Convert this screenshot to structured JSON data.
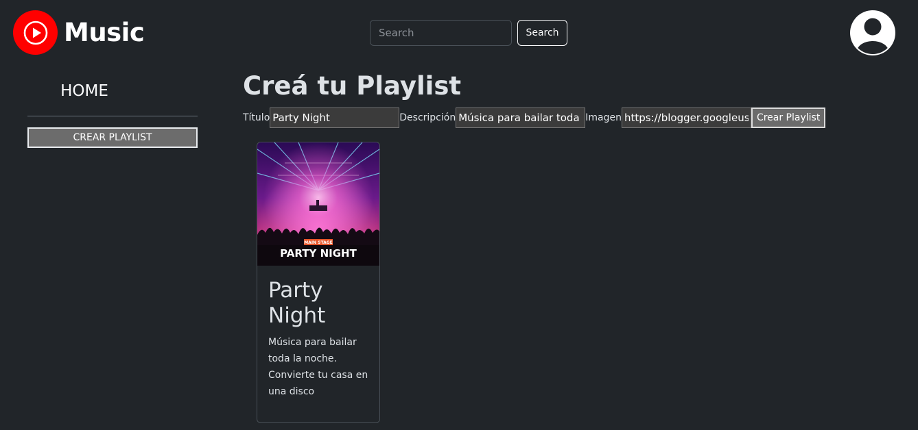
{
  "header": {
    "logo_text": "Music",
    "search": {
      "placeholder": "Search",
      "value": ""
    },
    "search_button_label": "Search"
  },
  "sidebar": {
    "home_label": "HOME",
    "create_button_label": "Crear playlist"
  },
  "main": {
    "title": "Creá tu Playlist",
    "form": {
      "title_label": "Título",
      "title_value": "Party Night",
      "description_label": "Descripción",
      "description_value": "Música para bailar toda la noche. Convierte tu casa en una disco",
      "image_label": "Imagen",
      "image_value": "https://blogger.googleusercontent.com",
      "submit_label": "Crear Playlist"
    },
    "playlists": [
      {
        "image_badge": "MAIN STAGE",
        "image_caption": "PARTY NIGHT",
        "title": "Party Night",
        "description": "Música para bailar toda la noche. Convierte tu casa en una disco"
      }
    ]
  },
  "colors": {
    "background": "#212529",
    "brand_red": "#ff0000",
    "text": "#dee2e6"
  },
  "icons": [
    "play-icon",
    "user-avatar-icon"
  ]
}
